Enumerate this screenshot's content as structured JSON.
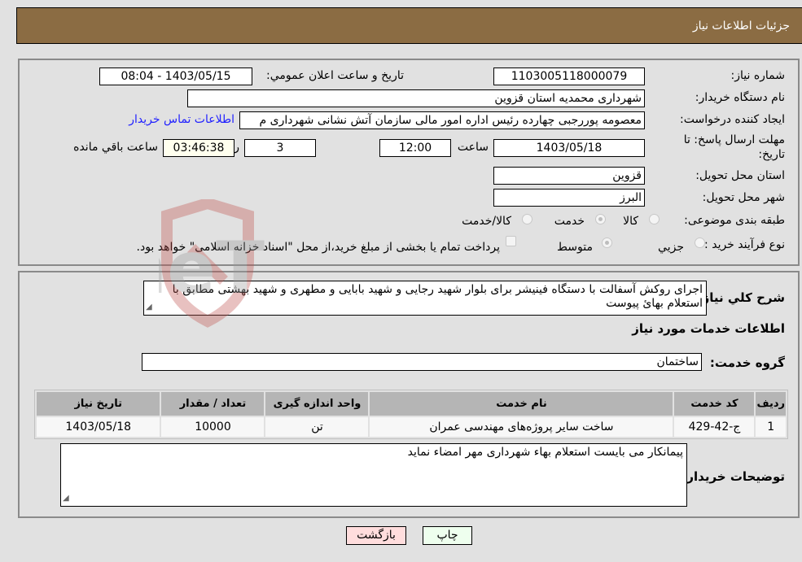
{
  "header": {
    "title": "جزئیات اطلاعات نیاز"
  },
  "fields": {
    "need_number": {
      "label": "شماره نیاز:",
      "value": "1103005118000079"
    },
    "announce_datetime": {
      "label": "تاریخ و ساعت اعلان عمومي:",
      "value": "1403/05/15 - 08:04"
    },
    "buyer_org": {
      "label": "نام دستگاه خریدار:",
      "value": "شهرداری محمدیه استان قزوین"
    },
    "requester": {
      "label": "ایجاد کننده درخواست:",
      "value": "معصومه پوررجبی چهارده رئیس اداره امور مالی سازمان آتش نشانی شهرداری م"
    },
    "buyer_contact_link": "اطلاعات تماس خریدار",
    "deadline": {
      "label_line1": "مهلت ارسال پاسخ: تا",
      "label_line2": "تاریخ:",
      "date": "1403/05/18",
      "time_label": "ساعت",
      "time": "12:00",
      "days": "3",
      "days_label": "روز و",
      "remaining": "03:46:38",
      "remaining_label": "ساعت باقي مانده"
    },
    "delivery_province": {
      "label": "استان محل تحویل:",
      "value": "قزوین"
    },
    "delivery_city": {
      "label": "شهر محل تحویل:",
      "value": "البرز"
    },
    "category": {
      "label": "طبقه بندی موضوعی:",
      "options": [
        "کالا",
        "خدمت",
        "کالا/خدمت"
      ],
      "selected": "خدمت"
    },
    "purchase_process": {
      "label": "نوع فرآیند خرید :",
      "options": [
        "جزيي",
        "متوسط"
      ],
      "selected": "متوسط",
      "treasury_note": "پرداخت تمام یا بخشی از مبلغ خرید،از محل \"اسناد خزانه اسلامی\" خواهد بود."
    }
  },
  "description": {
    "label": "شرح کلي نیاز:",
    "value": "اجرای روکش آسفالت با دستگاه فینیشر برای بلوار شهید رجایی و شهید بابایی و مطهری و شهید بهشتی مطابق با استعلام بهائ پیوست"
  },
  "services_section": {
    "title": "اطلاعات خدمات مورد نیاز",
    "group_label": "گروه خدمت:",
    "group_value": "ساختمان",
    "table": {
      "headers": [
        "ردیف",
        "کد خدمت",
        "نام خدمت",
        "واحد اندازه گیری",
        "تعداد / مقدار",
        "تاریخ نیاز"
      ],
      "rows": [
        [
          "1",
          "ج-42-429",
          "ساخت سایر پروژه‌های مهندسی عمران",
          "تن",
          "10000",
          "1403/05/18"
        ]
      ]
    }
  },
  "buyer_notes": {
    "label": "توضیحات خریدار:",
    "value": "پیمانکار می بایست استعلام بهاء شهرداری مهر امضاء نماید"
  },
  "buttons": {
    "print": "چاپ",
    "back": "بازگشت"
  },
  "watermark": "AriaTender.neT",
  "colors": {
    "header_bg": "#8b6c43",
    "link": "#2121ff",
    "print_bg": "#eeffee",
    "back_bg": "#ffdddd",
    "remaining_bg": "#ffffee"
  }
}
